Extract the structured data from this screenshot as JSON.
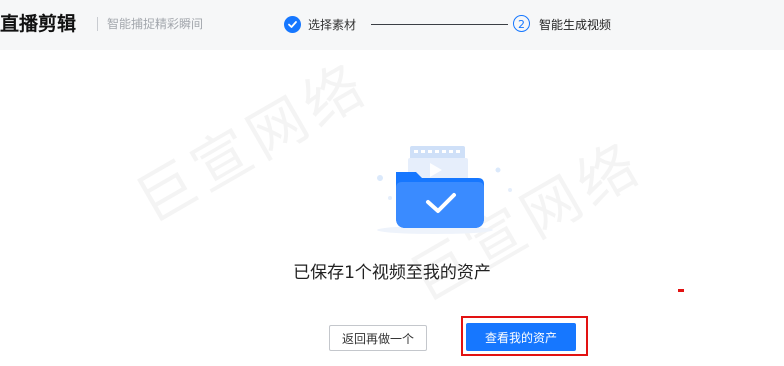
{
  "header": {
    "brand": "直播剪辑",
    "tagline": "智能捕捉精彩瞬间",
    "steps": [
      {
        "label": "选择素材",
        "state": "completed"
      },
      {
        "number": "2",
        "label": "智能生成视频",
        "state": "active"
      }
    ]
  },
  "watermark": {
    "text": "巨宣网络"
  },
  "main": {
    "illustration_icon": "video-folder-checkmark-icon",
    "message": "已保存1个视频至我的资产",
    "secondary_button": "返回再做一个",
    "primary_button": "查看我的资产"
  },
  "colors": {
    "accent": "#1677ff",
    "highlight": "#e21212",
    "topbar_bg": "#f6f7f8"
  }
}
